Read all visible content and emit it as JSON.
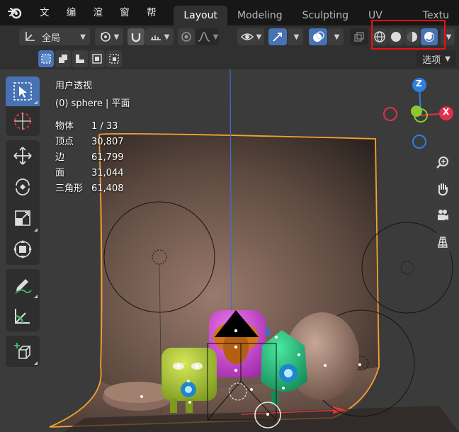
{
  "menu": {
    "items": [
      "文件",
      "编辑",
      "渲染",
      "窗口",
      "帮助"
    ]
  },
  "workspaces": [
    "Layout",
    "Modeling",
    "Sculpting",
    "UV Editing",
    "Textu"
  ],
  "header": {
    "transform_orientation": "全局"
  },
  "options_label": "选项",
  "viewport_overlay": {
    "view_name": "用户透视",
    "object_line": "(0) sphere | 平面",
    "stats": [
      {
        "label": "物体",
        "value": "1 / 33"
      },
      {
        "label": "顶点",
        "value": "30,807"
      },
      {
        "label": "边",
        "value": "61,799"
      },
      {
        "label": "面",
        "value": "31,044"
      },
      {
        "label": "三角形",
        "value": "61,408"
      }
    ]
  },
  "gizmo": {
    "z_label": "Z",
    "x_label": "X",
    "colors": {
      "x": "#e0304a",
      "y": "#8bc831",
      "z": "#2f7ee0"
    }
  },
  "accent": "#4772b3",
  "highlight_color": "#ee1111"
}
